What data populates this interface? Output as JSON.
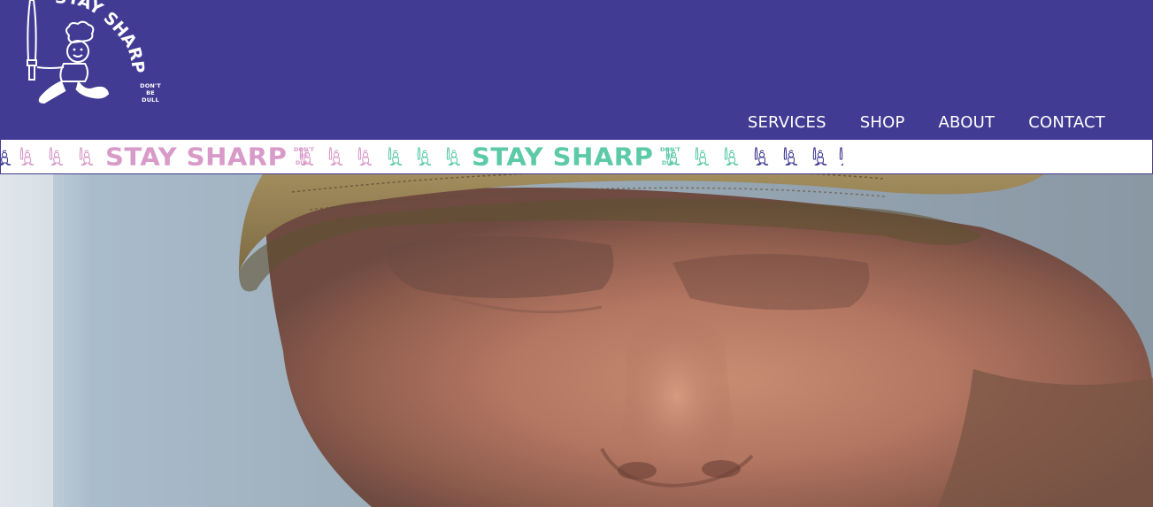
{
  "header": {
    "logo": {
      "brand_text": "STAY SHARP",
      "tagline_lines": [
        "DON'T",
        "BE",
        "DULL"
      ]
    },
    "nav": [
      {
        "label": "SERVICES"
      },
      {
        "label": "SHOP"
      },
      {
        "label": "ABOUT"
      },
      {
        "label": "CONTACT"
      }
    ]
  },
  "marquee": {
    "brand_text": "STAY SHARP",
    "tagline_lines": [
      "DON'T",
      "BE",
      "DULL"
    ],
    "colors": {
      "pink": "#d89ac8",
      "mint": "#5cc9a7",
      "indigo": "#423b94"
    }
  },
  "hero": {
    "media": "video-still-man-in-cap"
  },
  "theme": {
    "header_bg": "#423b94",
    "text": "#ffffff"
  }
}
